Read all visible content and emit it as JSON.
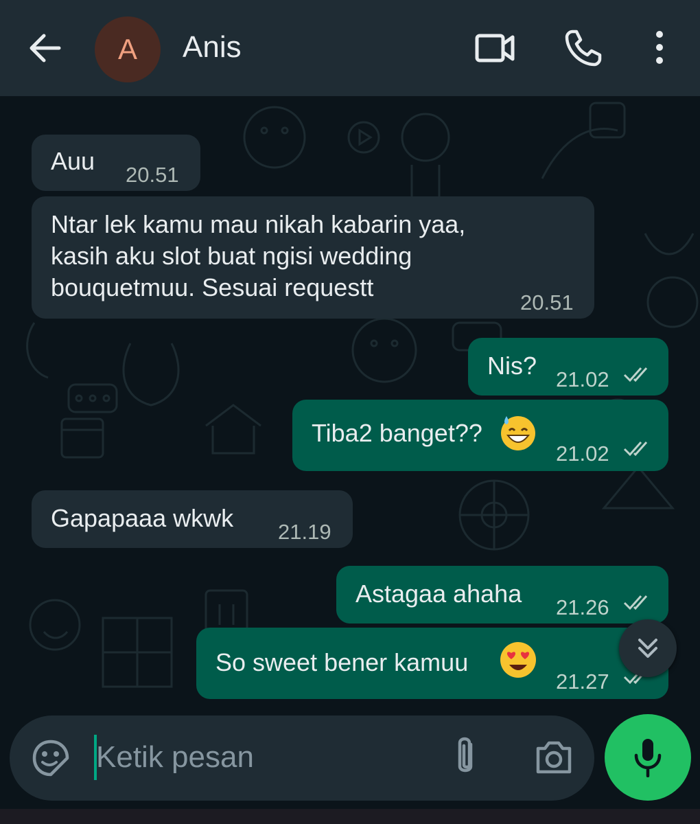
{
  "contact": {
    "initial": "A",
    "name": "Anis"
  },
  "header_icons": [
    "back-arrow-icon",
    "video-call-icon",
    "phone-icon",
    "more-vertical-icon"
  ],
  "messages": [
    {
      "direction": "incoming",
      "text": "Auu",
      "time": "20.51"
    },
    {
      "direction": "incoming",
      "lines": [
        "Ntar lek kamu mau nikah kabarin yaa,",
        "kasih aku slot buat ngisi wedding",
        "bouquetmuu. Sesuai requestt"
      ],
      "time": "20.51"
    },
    {
      "direction": "outgoing",
      "text": "Nis?",
      "time": "21.02",
      "status": "read-double-check"
    },
    {
      "direction": "outgoing",
      "text": "Tiba2 banget??",
      "emoji": "grinning-face-with-sweat",
      "time": "21.02",
      "status": "read-double-check"
    },
    {
      "direction": "incoming",
      "text": "Gapapaaa wkwk",
      "time": "21.19"
    },
    {
      "direction": "outgoing",
      "text": "Astagaa ahaha",
      "time": "21.26",
      "status": "read-double-check"
    },
    {
      "direction": "outgoing",
      "text": "So sweet bener kamuu",
      "emoji": "smiling-face-with-heart-eyes",
      "time": "21.27",
      "status": "read-double-check"
    }
  ],
  "composer": {
    "placeholder": "Ketik pesan"
  },
  "colors": {
    "header": "#1f2c34",
    "background": "#0b141a",
    "incoming_bubble": "#1f2c34",
    "outgoing_bubble": "#005c4b",
    "mic_button": "#21c063",
    "accent": "#00a884"
  }
}
